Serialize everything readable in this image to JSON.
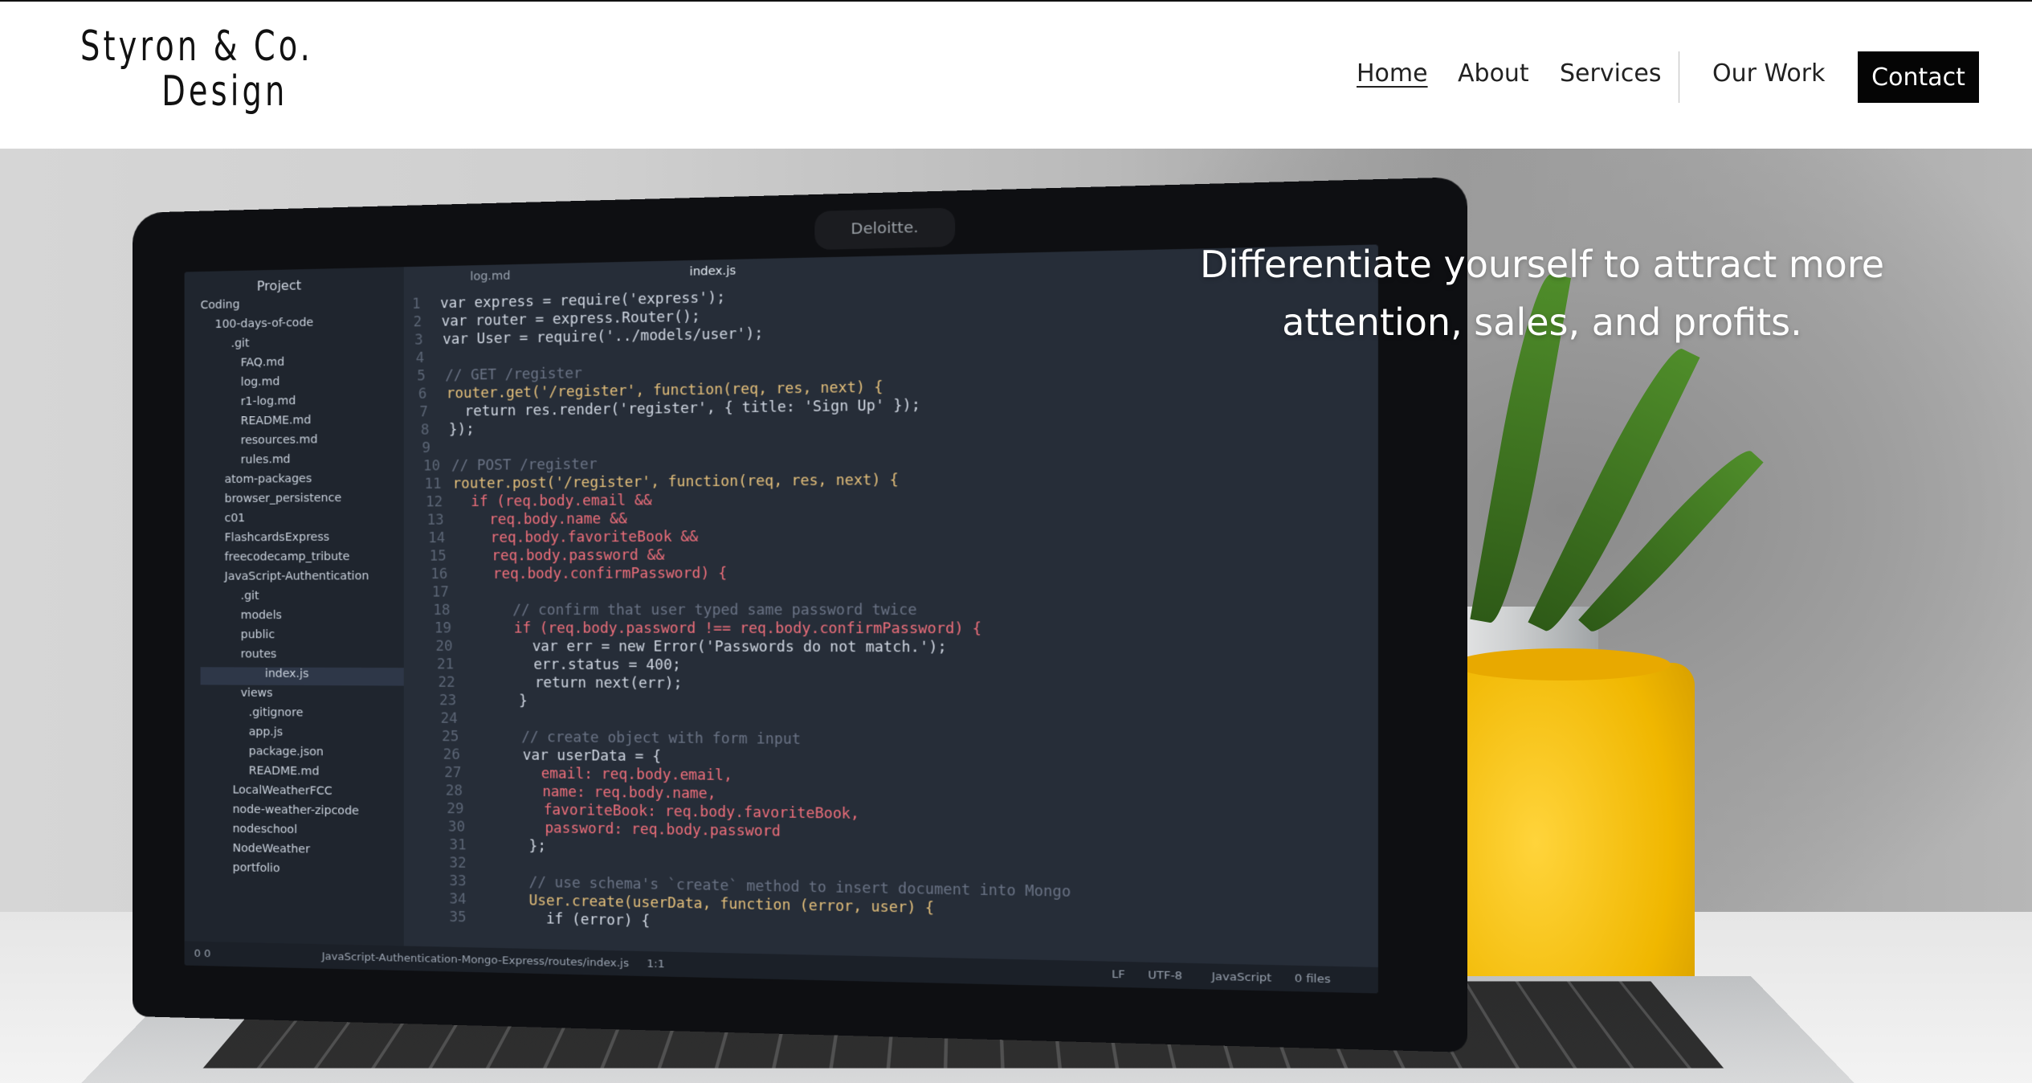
{
  "brand": {
    "line1": "Styron & Co.",
    "line2": "Design"
  },
  "nav": {
    "home": "Home",
    "about": "About",
    "services": "Services",
    "our_work": "Our Work",
    "contact": "Contact"
  },
  "hero": {
    "tagline_line1": "Differentiate yourself to attract more",
    "tagline_line2": "attention, sales, and profits."
  },
  "laptop": {
    "camera_label": "Deloitte.",
    "sidebar_title": "Project",
    "tabs": [
      "log.md",
      "index.js"
    ],
    "tree": [
      "Coding",
      "100-days-of-code",
      ".git",
      "FAQ.md",
      "log.md",
      "r1-log.md",
      "README.md",
      "resources.md",
      "rules.md",
      "atom-packages",
      "browser_persistence",
      "c01",
      "FlashcardsExpress",
      "freecodecamp_tribute",
      "JavaScript-Authentication",
      ".git",
      "models",
      "public",
      "routes",
      "index.js",
      "views",
      ".gitignore",
      "app.js",
      "package.json",
      "README.md",
      "LocalWeatherFCC",
      "node-weather-zipcode",
      "nodeschool",
      "NodeWeather",
      "portfolio"
    ],
    "code": [
      "var express = require('express');",
      "var router = express.Router();",
      "var User = require('../models/user');",
      "",
      "// GET /register",
      "router.get('/register', function(req, res, next) {",
      "  return res.render('register', { title: 'Sign Up' });",
      "});",
      "",
      "// POST /register",
      "router.post('/register', function(req, res, next) {",
      "  if (req.body.email &&",
      "    req.body.name &&",
      "    req.body.favoriteBook &&",
      "    req.body.password &&",
      "    req.body.confirmPassword) {",
      "",
      "      // confirm that user typed same password twice",
      "      if (req.body.password !== req.body.confirmPassword) {",
      "        var err = new Error('Passwords do not match.');",
      "        err.status = 400;",
      "        return next(err);",
      "      }",
      "",
      "      // create object with form input",
      "      var userData = {",
      "        email: req.body.email,",
      "        name: req.body.name,",
      "        favoriteBook: req.body.favoriteBook,",
      "        password: req.body.password",
      "      };",
      "",
      "      // use schema's `create` method to insert document into Mongo",
      "      User.create(userData, function (error, user) {",
      "        if (error) {"
    ],
    "status_path": "JavaScript-Authentication-Mongo-Express/routes/index.js",
    "status_pos": "1:1",
    "status_lf": "LF",
    "status_enc": "UTF-8",
    "status_lang": "JavaScript",
    "status_files": "0 files",
    "status_counts": "0  0"
  },
  "colors": {
    "nav_contact_bg": "#050505",
    "tagline": "#ffffff"
  }
}
